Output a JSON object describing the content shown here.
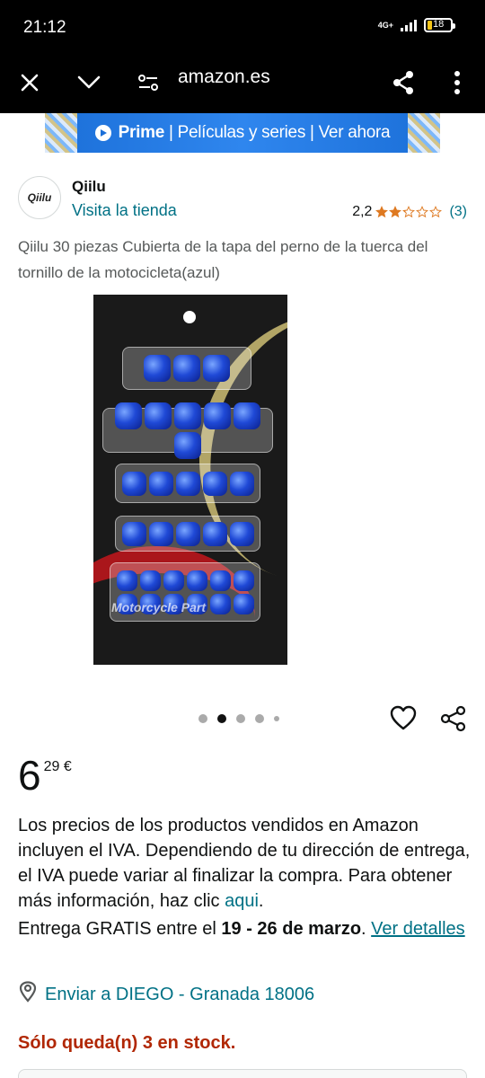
{
  "status_bar": {
    "time": "21:12",
    "network": "4G+",
    "battery": "18"
  },
  "browser": {
    "url": "amazon.es"
  },
  "banner": {
    "brand": "Prime",
    "text": "| Películas y series | Ver ahora"
  },
  "brand": {
    "logo_text": "Qiilu",
    "name": "Qiilu",
    "store_link": "Visita la tienda"
  },
  "rating": {
    "value": "2,2",
    "stars": 2.2,
    "count": "(3)"
  },
  "product": {
    "title": "Qiilu 30 piezas Cubierta de la tapa del perno de la tuerca del tornillo de la motocicleta(azul)",
    "image_text": "Motorcycle Part"
  },
  "carousel": {
    "total": 5,
    "active": 2
  },
  "price": {
    "whole": "6",
    "fraction": "29 €"
  },
  "iva": {
    "text": "Los precios de los productos vendidos en Amazon incluyen el IVA. Dependiendo de tu dirección de entrega, el IVA puede variar al finalizar la compra. Para obtener más información, haz clic ",
    "link": "aqui",
    "end": "."
  },
  "delivery": {
    "prefix": "Entrega GRATIS entre el ",
    "dates": "19 - 26 de marzo",
    "suffix": ". ",
    "link": "Ver detalles"
  },
  "ship_to": "Enviar a DIEGO - Granada 18006",
  "stock": "Sólo queda(n) 3 en stock.",
  "colors": {
    "link": "#007185",
    "stock": "#b12704",
    "prime": "#1b6fd8",
    "star": "#de7921"
  }
}
